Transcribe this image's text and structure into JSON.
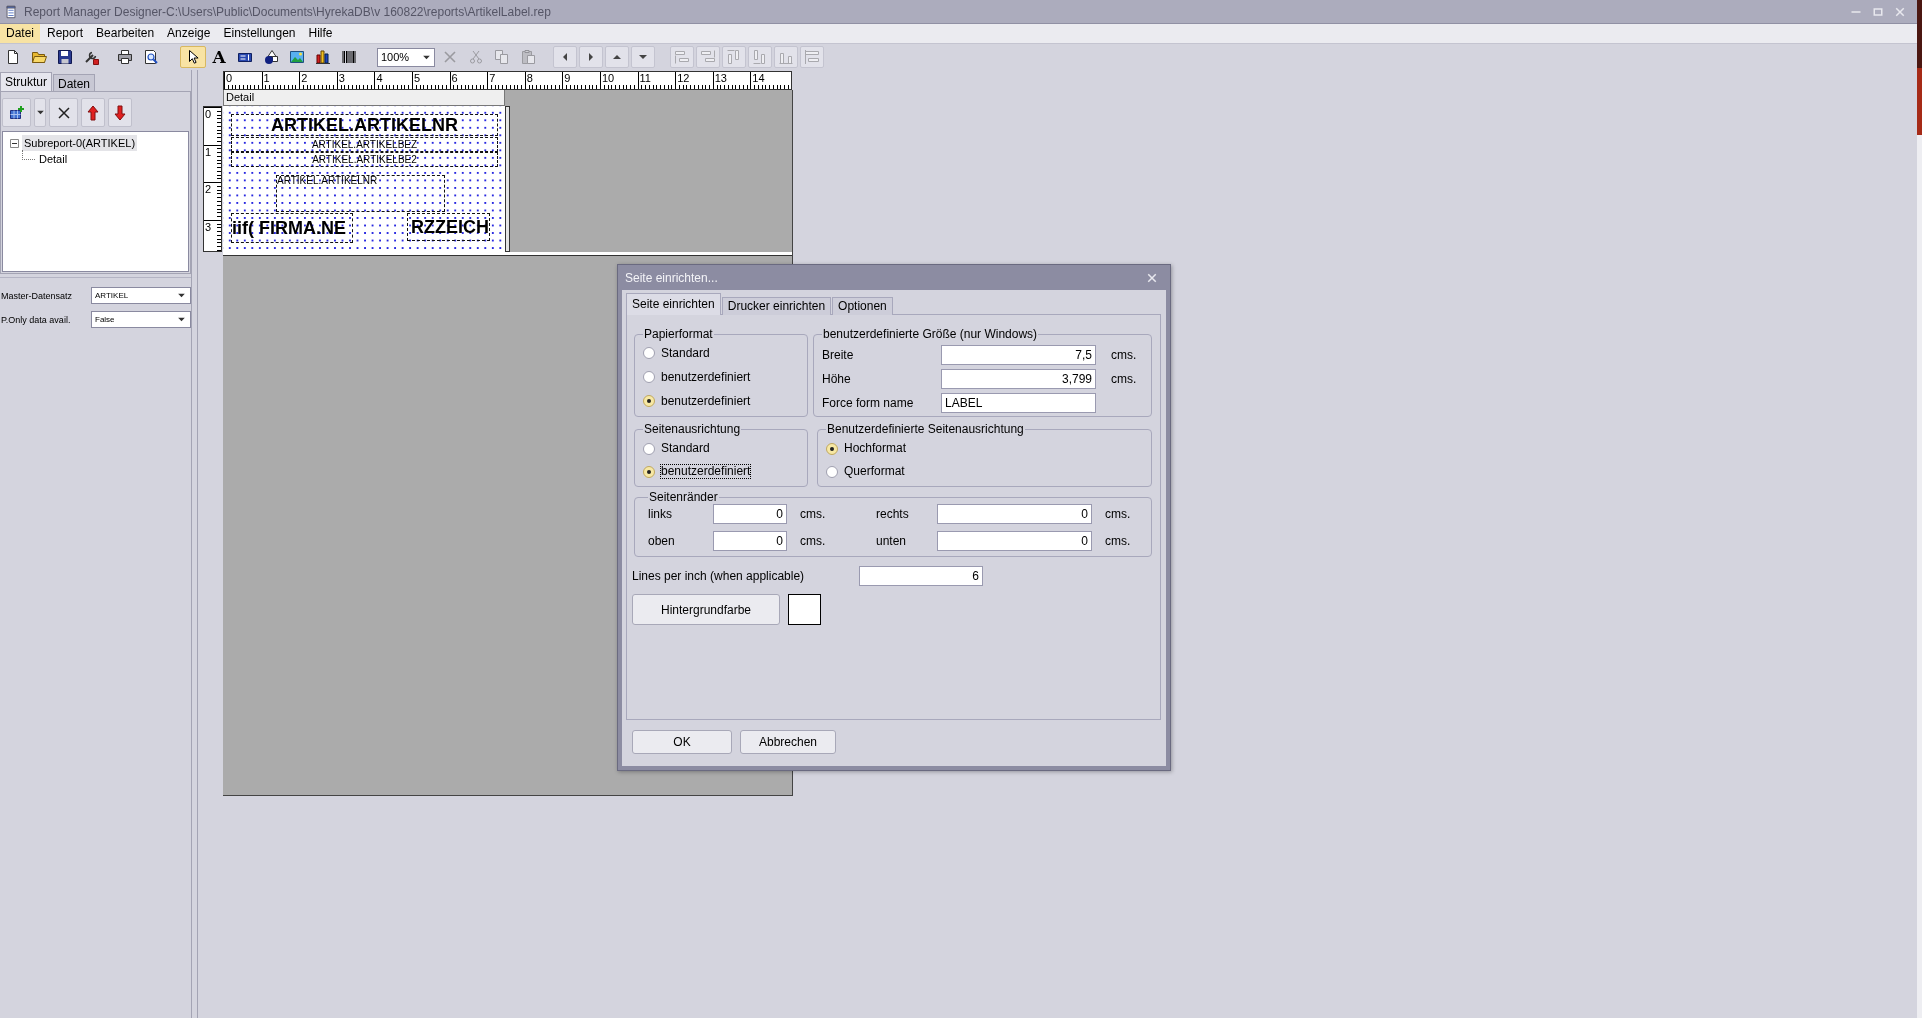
{
  "window": {
    "title": "Report Manager Designer-C:\\Users\\Public\\Documents\\HyrekaDB\\v 160822\\reports\\ArtikelLabel.rep"
  },
  "menu": [
    {
      "label": "Datei",
      "selected": true
    },
    {
      "label": "Report",
      "selected": false
    },
    {
      "label": "Bearbeiten",
      "selected": false
    },
    {
      "label": "Anzeige",
      "selected": false
    },
    {
      "label": "Einstellungen",
      "selected": false
    },
    {
      "label": "Hilfe",
      "selected": false
    }
  ],
  "toolbar": {
    "insert_tools": [
      {
        "selected": true
      },
      {
        "selected": false,
        "glyph": "A"
      },
      {
        "selected": false
      },
      {
        "selected": false
      },
      {
        "selected": false
      },
      {
        "selected": false
      },
      {
        "selected": false
      }
    ],
    "zoom": "100%",
    "edit_buttons": [
      {
        "disabled": true
      },
      {
        "disabled": true
      },
      {
        "disabled": true
      },
      {
        "disabled": true
      }
    ],
    "align_buttons": [
      {
        "disabled": true
      },
      {
        "disabled": true
      },
      {
        "disabled": true
      },
      {
        "disabled": true
      },
      {
        "disabled": true
      },
      {
        "disabled": true
      }
    ]
  },
  "left_panel": {
    "tabs": [
      {
        "label": "Struktur",
        "selected": true
      },
      {
        "label": "Daten",
        "selected": false
      }
    ],
    "tree": [
      {
        "label": "Subreport-0(ARTIKEL)",
        "expanded": true,
        "selected": true,
        "children": [
          {
            "label": "Detail",
            "selected": false
          }
        ]
      }
    ],
    "properties": [
      {
        "label": "Master-Datensatz",
        "value": "ARTIKEL"
      },
      {
        "label": "P.Only data avail.",
        "value": "False"
      }
    ]
  },
  "designer": {
    "ruler": [
      "0",
      "1",
      "2",
      "3",
      "4",
      "5",
      "6",
      "7",
      "8",
      "9",
      "10",
      "11",
      "12",
      "13",
      "14"
    ],
    "section": {
      "title": "Detail",
      "ruler": [
        "0",
        "1",
        "2",
        "3"
      ],
      "fields": [
        {
          "text": "ARTIKEL.ARTIKELNR",
          "kind": "large"
        },
        {
          "text": "ARTIKEL.ARTIKELBEZ",
          "kind": "small"
        },
        {
          "text": "ARTIKEL.ARTIKELBE2",
          "kind": "small"
        },
        {
          "text": "ARTIKEL.ARTIKELNR",
          "kind": "small"
        },
        {
          "text": "iif( FIRMA.NE",
          "kind": "large"
        },
        {
          "text": "RZZEICH",
          "kind": "large"
        }
      ]
    }
  },
  "dialog": {
    "title": "Seite einrichten...",
    "tabs": [
      {
        "label": "Seite einrichten",
        "selected": true
      },
      {
        "label": "Drucker einrichten",
        "selected": false
      },
      {
        "label": "Optionen",
        "selected": false
      }
    ],
    "paper_format": {
      "title": "Papierformat",
      "options": [
        {
          "label": "Standard",
          "selected": false,
          "focused": false
        },
        {
          "label": "benutzerdefiniert",
          "selected": false,
          "focused": false
        },
        {
          "label": "benutzerdefiniert",
          "selected": true,
          "focused": false
        }
      ]
    },
    "custom_size": {
      "title": "benutzerdefinierte Größe (nur Windows)",
      "fields": [
        {
          "label": "Breite",
          "value": "7,5",
          "unit": "cms.",
          "kind": "number"
        },
        {
          "label": "Höhe",
          "value": "3,799",
          "unit": "cms.",
          "kind": "number"
        },
        {
          "label": "Force form name",
          "value": "LABEL",
          "kind": "text"
        }
      ]
    },
    "orientation": {
      "title": "Seitenausrichtung",
      "options": [
        {
          "label": "Standard",
          "selected": false,
          "focused": false
        },
        {
          "label": "benutzerdefiniert",
          "selected": true,
          "focused": true
        }
      ]
    },
    "custom_orientation": {
      "title": "Benutzerdefinierte Seitenausrichtung",
      "options": [
        {
          "label": "Hochformat",
          "selected": true,
          "focused": false
        },
        {
          "label": "Querformat",
          "selected": false,
          "focused": false
        }
      ]
    },
    "margins": {
      "title": "Seitenränder",
      "fields": [
        {
          "label": "links",
          "value": "0",
          "unit": "cms."
        },
        {
          "label": "rechts",
          "value": "0",
          "unit": "cms."
        },
        {
          "label": "oben",
          "value": "0",
          "unit": "cms."
        },
        {
          "label": "unten",
          "value": "0",
          "unit": "cms."
        }
      ]
    },
    "lines_per_inch": {
      "label": "Lines per inch (when applicable)",
      "value": "6"
    },
    "background_color": {
      "button": "Hintergrundfarbe",
      "color": "#ffffff"
    },
    "buttons": [
      {
        "label": "OK"
      },
      {
        "label": "Abbrechen"
      }
    ]
  }
}
